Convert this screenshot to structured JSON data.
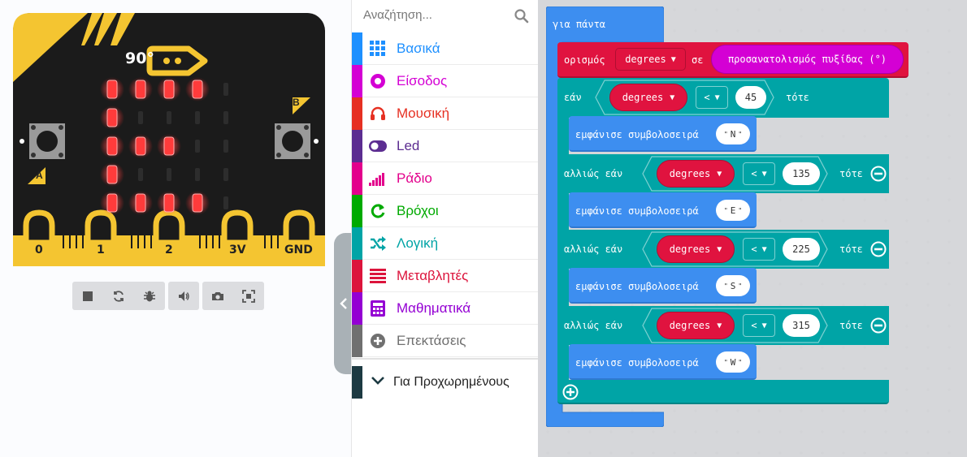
{
  "simulator": {
    "compass_heading": "90°",
    "pins": [
      "0",
      "1",
      "2",
      "3V",
      "GND"
    ],
    "buttons": [
      "A",
      "B"
    ],
    "led_matrix": [
      [
        1,
        1,
        1,
        1,
        0
      ],
      [
        1,
        0,
        0,
        0,
        0
      ],
      [
        1,
        1,
        1,
        0,
        0
      ],
      [
        1,
        0,
        0,
        0,
        0
      ],
      [
        1,
        1,
        1,
        1,
        0
      ]
    ],
    "toolbar_icons": [
      "stop-icon",
      "restart-icon",
      "debug-icon",
      "sound-icon",
      "screenshot-icon",
      "fullscreen-icon"
    ]
  },
  "toolbox": {
    "search_placeholder": "Αναζήτηση...",
    "categories": [
      {
        "label": "Βασικά",
        "color": "#1E90FF",
        "icon": "grid-icon"
      },
      {
        "label": "Είσοδος",
        "color": "#D400D4",
        "icon": "input-icon"
      },
      {
        "label": "Μουσική",
        "color": "#E63022",
        "icon": "headphones-icon"
      },
      {
        "label": "Led",
        "color": "#5C2D91",
        "icon": "toggle-icon"
      },
      {
        "label": "Ράδιο",
        "color": "#E3008C",
        "icon": "signal-icon"
      },
      {
        "label": "Βρόχοι",
        "color": "#00AA00",
        "icon": "refresh-icon"
      },
      {
        "label": "Λογική",
        "color": "#00A4A6",
        "icon": "shuffle-icon"
      },
      {
        "label": "Μεταβλητές",
        "color": "#DC143C",
        "icon": "list-icon"
      },
      {
        "label": "Μαθηματικά",
        "color": "#9400D3",
        "icon": "calculator-icon"
      },
      {
        "label": "Επεκτάσεις",
        "color": "#707070",
        "icon": "plus-circle-icon"
      }
    ],
    "advanced_label": "Για Προχωρημένους"
  },
  "workspace": {
    "forever_label": "για πάντα",
    "set_label": "ορισμός",
    "to_label": "σε",
    "var_name": "degrees",
    "compass_label": "προσανατολισμός πυξίδας (°)",
    "if_label": "εάν",
    "else_if_label": "αλλιώς εάν",
    "then_label": "τότε",
    "operator": "<",
    "show_string_label": "εμφάνισε συμβολοσειρά",
    "quote": "\"",
    "branches": [
      {
        "threshold": "45",
        "text": "N"
      },
      {
        "threshold": "135",
        "text": "E"
      },
      {
        "threshold": "225",
        "text": "S"
      },
      {
        "threshold": "315",
        "text": "W"
      }
    ]
  }
}
